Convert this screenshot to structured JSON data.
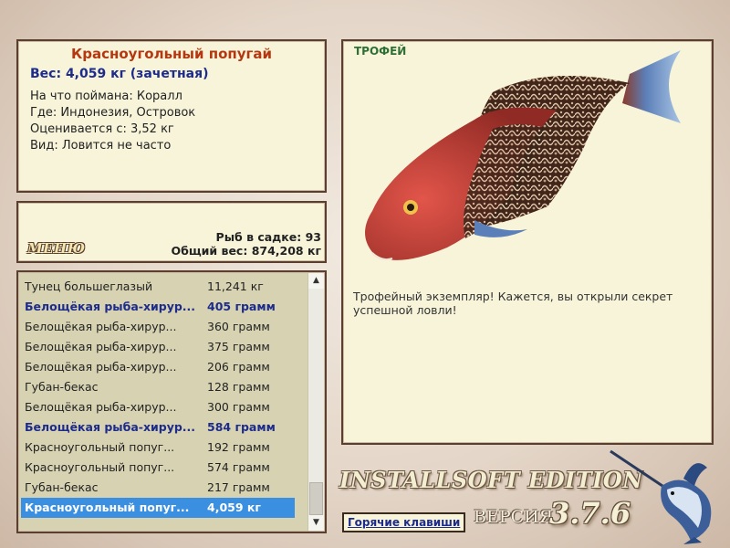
{
  "info": {
    "fish_name": "Красноугольный попугай",
    "weight": "Вес: 4,059 кг (зачетная)",
    "lines": [
      "На что поймана: Коралл",
      "Где: Индонезия, Островок",
      "Оценивается с: 3,52 кг",
      "Вид: Ловится не часто"
    ]
  },
  "menu": {
    "label": "МЕНЮ",
    "fish_count": "Рыб в садке: 93",
    "total_weight": "Общий вес: 874,208 кг"
  },
  "catch_list": [
    {
      "name": "Тунец большеглазый",
      "weight": "11,241 кг",
      "style": "normal"
    },
    {
      "name": "Белощёкая рыба-хирур...",
      "weight": "405 грамм",
      "style": "bold"
    },
    {
      "name": "Белощёкая рыба-хирур...",
      "weight": "360 грамм",
      "style": "normal"
    },
    {
      "name": "Белощёкая рыба-хирур...",
      "weight": "375 грамм",
      "style": "normal"
    },
    {
      "name": "Белощёкая рыба-хирур...",
      "weight": "206 грамм",
      "style": "normal"
    },
    {
      "name": "Губан-бекас",
      "weight": "128 грамм",
      "style": "normal"
    },
    {
      "name": "Белощёкая рыба-хирур...",
      "weight": "300 грамм",
      "style": "normal"
    },
    {
      "name": "Белощёкая рыба-хирур...",
      "weight": "584 грамм",
      "style": "bold"
    },
    {
      "name": "Красноугольный попуг...",
      "weight": "192 грамм",
      "style": "normal"
    },
    {
      "name": "Красноугольный попуг...",
      "weight": "574 грамм",
      "style": "normal"
    },
    {
      "name": "Губан-бекас",
      "weight": "217 грамм",
      "style": "normal"
    },
    {
      "name": "Красноугольный попуг...",
      "weight": "4,059 кг",
      "style": "selected"
    }
  ],
  "trophy": {
    "tag": "ТРОФЕЙ",
    "message": "Трофейный экземпляр! Кажется, вы открыли секрет успешной ловли!",
    "fish_image": "parrotfish-image"
  },
  "footer": {
    "brand": "INSTALLSOFT EDITION",
    "hotkeys": "Горячие клавиши",
    "version_label": "ВЕРСИЯ",
    "version_number": "3.7.6",
    "logo": "marlin-logo"
  },
  "colors": {
    "panel": "#f7f4d9",
    "border": "#5a3f2e",
    "title_red": "#b5370f",
    "bold_blue": "#1d2c8c",
    "selection": "#3b8fe0",
    "trophy_green": "#2f6f35"
  },
  "icons": {
    "scroll_up": "arrow-up-icon",
    "scroll_down": "arrow-down-icon"
  }
}
